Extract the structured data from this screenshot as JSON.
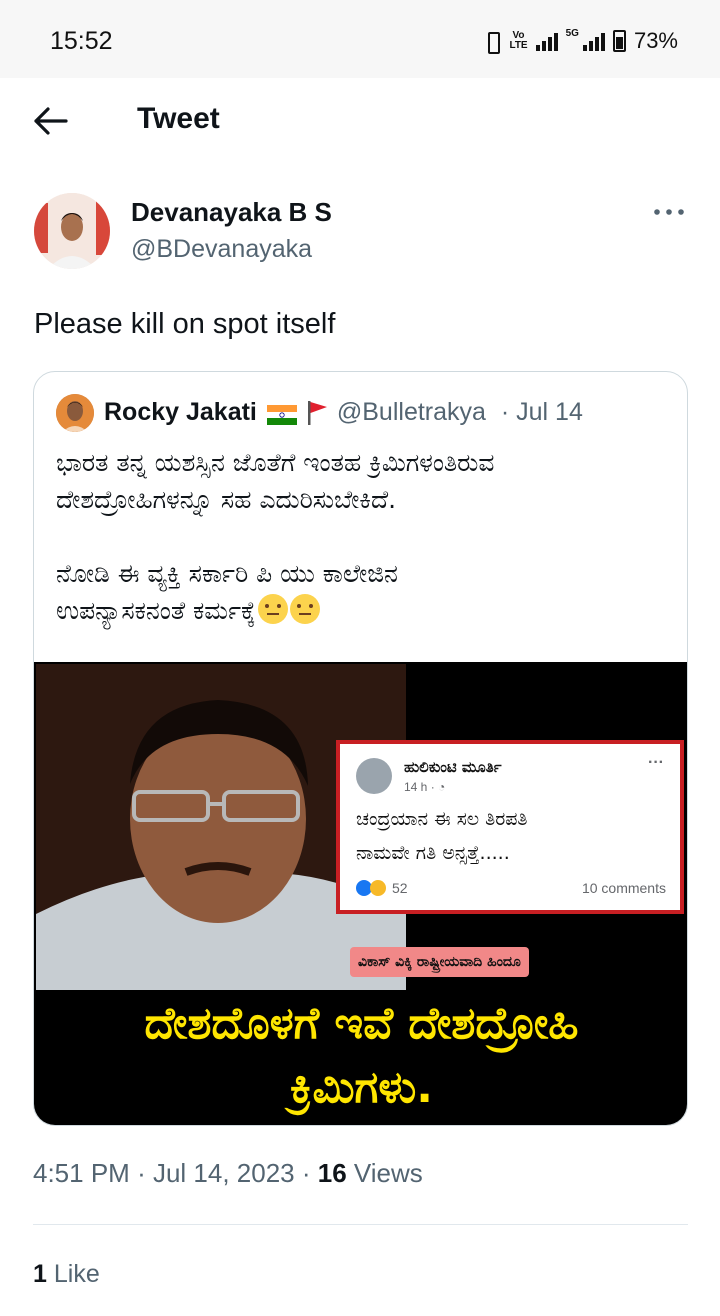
{
  "status_bar": {
    "time": "15:52",
    "volte": "Vo\nLTE",
    "network": "5G",
    "battery": "73%"
  },
  "header": {
    "title": "Tweet",
    "back_icon": "arrow-left-icon"
  },
  "tweet": {
    "author_name": "Devanayaka B S",
    "author_handle": "@BDevanayaka",
    "text": "Please kill on spot itself",
    "time": "4:51 PM",
    "date": "Jul 14, 2023",
    "views_count": "16",
    "views_label": "Views",
    "likes_count": "1",
    "likes_label": "Like"
  },
  "quote": {
    "author_name": "Rocky Jakati",
    "author_handle": "@Bulletrakya",
    "date": "Jul 14",
    "text_line1": "ಭಾರತ ತನ್ನ ಯಶಸ್ಸಿನ ಜೊತೆಗೆ ಇಂತಹ ಕ್ರಿಮಿಗಳಂತಿರುವ\nದೇಶದ್ರೋಹಿಗಳನ್ನೂ ಸಹ ಎದುರಿಸುಬೇಕಿದೆ.",
    "text_line2": "ನೋಡಿ ಈ ವ್ಯಕ್ತಿ ಸರ್ಕಾರಿ ಪಿ ಯು ಕಾಲೇಜಿನ\nಉಪನ್ಯಾಸಕನಂತೆ ಕರ್ಮಕ್ಕೆ",
    "emoji": "unamused-face-icon"
  },
  "media": {
    "fb_name": "ಹುಲಿಕುಂಟಿ ಮೂರ್ತಿ",
    "fb_time": "14 h · ",
    "fb_text": "ಚಂದ್ರಯಾನ ಈ ಸಲ ತಿರಪತಿ\nನಾಮವೇ ಗತಿ ಅನ್ಸತ್ತೆ.....",
    "fb_reactions": "52",
    "fb_comments": "10 comments",
    "credit": "ವಿಕಾಸ್ ವಿಕ್ಕಿ ರಾಷ್ಟ್ರೀಯವಾದಿ ಹಿಂದೂ",
    "caption": "ದೇಶದೊಳಗೆ ಇವೆ ದೇಶದ್ರೋಹಿ\nಕ್ರಿಮಿಗಳು."
  },
  "colors": {
    "text": "#0f1419",
    "secondary": "#536471",
    "border": "#cfd9de",
    "caption_yellow": "#ffe600",
    "fb_card_border": "#c81f23"
  }
}
